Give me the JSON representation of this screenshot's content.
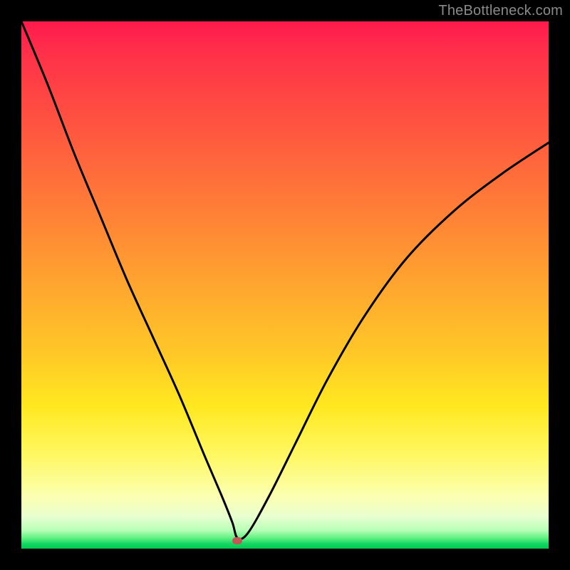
{
  "watermark": "TheBottleneck.com",
  "chart_data": {
    "type": "line",
    "title": "",
    "xlabel": "",
    "ylabel": "",
    "xlim": [
      0,
      100
    ],
    "ylim": [
      0,
      100
    ],
    "grid": false,
    "legend": false,
    "series": [
      {
        "name": "bottleneck-curve",
        "x": [
          0,
          5,
          10,
          15,
          20,
          25,
          30,
          35,
          38,
          40,
          41,
          43,
          47,
          52,
          58,
          65,
          73,
          82,
          91,
          100
        ],
        "values": [
          100,
          88,
          75,
          63,
          51,
          40,
          29,
          17,
          10,
          5,
          2,
          3,
          10,
          20,
          32,
          44,
          55,
          64,
          71,
          77
        ]
      }
    ],
    "marker": {
      "x": 41,
      "y": 1.5
    },
    "background_gradient": {
      "stops": [
        {
          "pos": 0.0,
          "color": "#ff1a4d"
        },
        {
          "pos": 0.48,
          "color": "#ffa030"
        },
        {
          "pos": 0.82,
          "color": "#fff860"
        },
        {
          "pos": 0.97,
          "color": "#60f080"
        },
        {
          "pos": 1.0,
          "color": "#00c84e"
        }
      ]
    }
  }
}
